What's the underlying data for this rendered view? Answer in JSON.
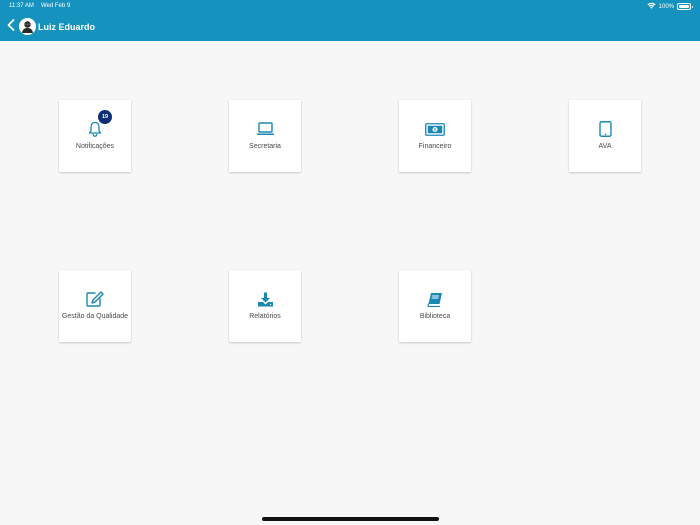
{
  "status_bar": {
    "time": "11:37 AM",
    "date": "Wed Feb 9",
    "battery": "100%",
    "wifi_icon": "wifi-icon",
    "battery_icon": "battery-icon"
  },
  "header": {
    "user_name": "Luiz Eduardo",
    "back_icon": "chevron-left-icon",
    "avatar_icon": "avatar-icon",
    "bar_color": "#1592bd"
  },
  "menu": {
    "icon_color": "#1b87b3",
    "badge_color": "#0f2f75",
    "items": [
      {
        "label": "Notificações",
        "icon": "bell-icon",
        "badge": "19"
      },
      {
        "label": "Secretaria",
        "icon": "laptop-icon"
      },
      {
        "label": "Financeiro",
        "icon": "money-icon"
      },
      {
        "label": "AVA",
        "icon": "tablet-icon"
      },
      {
        "label": "Gestão da Qualidade",
        "icon": "edit-icon"
      },
      {
        "label": "Relatórios",
        "icon": "download-icon"
      },
      {
        "label": "Biblioteca",
        "icon": "book-icon"
      }
    ]
  }
}
